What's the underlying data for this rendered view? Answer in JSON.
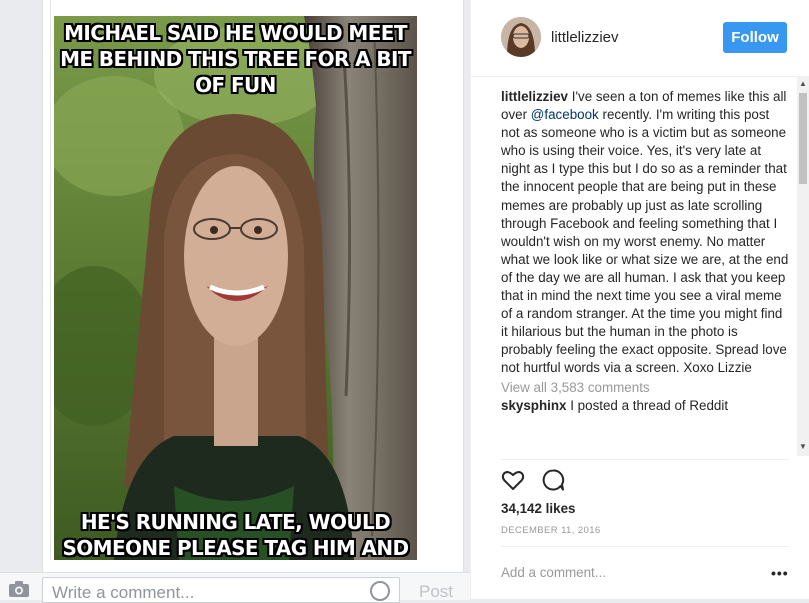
{
  "fb_post": {
    "meme_top_text": "MICHAEL SAID HE WOULD MEET ME BEHIND THIS TREE FOR A BIT OF FUN",
    "meme_bottom_text": "HE'S RUNNING LATE, WOULD SOMEONE PLEASE TAG HIM AND TELL HIM I'M STILL WAITING?",
    "comment_placeholder": "Write a comment...",
    "post_label": "Post",
    "camera_icon": "camera-icon",
    "emoji_icon": "emoji-icon"
  },
  "instagram": {
    "username": "littlelizziev",
    "follow_label": "Follow",
    "caption_user": "littlelizziev",
    "caption_part1": "I've seen a ton of memes like this all over",
    "caption_mention": "@facebook",
    "caption_part2": "recently. I'm writing this post not as someone who is a victim but as someone who is using their voice. Yes, it's very late at night as I type this but I do so as a reminder that the innocent people that are being put in these memes are probably up just as late scrolling through Facebook and feeling something that I wouldn't wish on my worst enemy. No matter what we look like or what size we are, at the end of the day we are all human. I ask that you keep that in mind the next time you see a viral meme of a random stranger. At the time you might find it hilarious but the human in the photo is probably feeling the exact opposite. Spread love not hurtful words via a screen. Xoxo Lizzie",
    "view_comments": "View all 3,583 comments",
    "comment_user": "skysphinx",
    "comment_text": "I posted a thread of Reddit",
    "likes": "34,142 likes",
    "date": "DECEMBER 11, 2016",
    "add_comment_placeholder": "Add a comment...",
    "more_label": "•••",
    "icons": [
      "heart-icon",
      "comment-icon",
      "more-options-icon"
    ],
    "accent_color": "#3897f0"
  }
}
